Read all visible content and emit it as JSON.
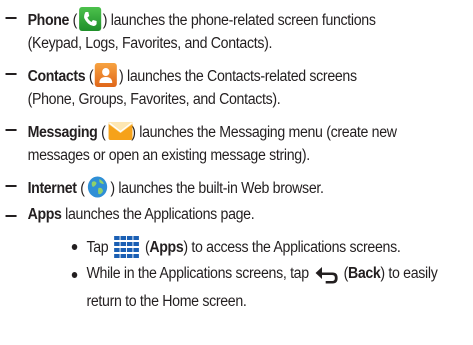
{
  "items": [
    {
      "name": "Phone",
      "before": "",
      "open": " (",
      "close": ") launches the phone-related screen functions",
      "line2": "(Keypad, Logs, Favorites, and Contacts)."
    },
    {
      "name": "Contacts",
      "open": " (",
      "close": ") launches the Contacts-related screens",
      "line2": "(Phone, Groups, Favorites, and Contacts)."
    },
    {
      "name": "Messaging",
      "open": " (",
      "close": ") launches the Messaging menu (create new",
      "line2": "messages or open an existing message string)."
    },
    {
      "name": "Internet",
      "open": " (",
      "close": ") launches the built-in Web browser."
    },
    {
      "name": "Apps",
      "close": " launches the Applications page."
    }
  ],
  "subitems": [
    {
      "pre": "Tap ",
      "open": " (",
      "name": "Apps",
      "close": ") to access the Applications screens."
    },
    {
      "pre": "While in the Applications screens, tap ",
      "open": " (",
      "name": "Back",
      "close": ") to easily",
      "line2": "return to the Home screen."
    }
  ],
  "colors": {
    "text": "#231f20",
    "phone": "#2aa83a",
    "contacts": "#ee7b2a",
    "apps_grid": "#1a5fb4"
  },
  "icons": [
    "phone-icon",
    "contacts-icon",
    "messaging-icon",
    "internet-icon",
    "apps-grid-icon",
    "back-arrow-icon"
  ]
}
